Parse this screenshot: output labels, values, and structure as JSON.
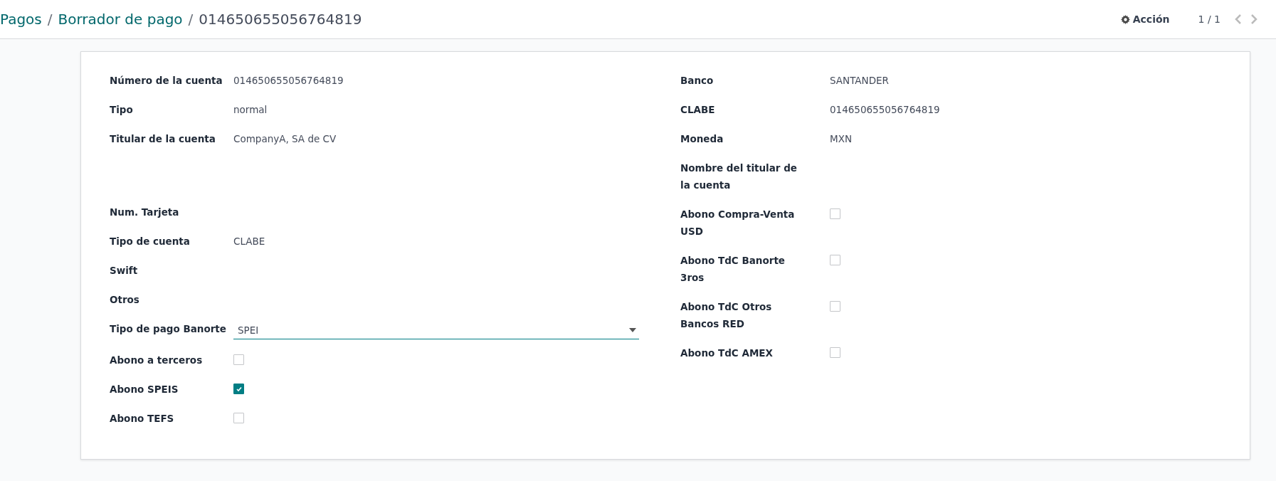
{
  "breadcrumbs": [
    {
      "label": "Pagos",
      "kind": "link"
    },
    {
      "label": "Borrador de pago",
      "kind": "link"
    },
    {
      "label": "014650655056764819",
      "kind": "current"
    }
  ],
  "separator": "/",
  "action_button": {
    "label": "Acción"
  },
  "pager": {
    "text": "1 / 1"
  },
  "left_fields": [
    {
      "label": "Número de la cuenta",
      "kind": "text",
      "value": "014650655056764819"
    },
    {
      "label": "Tipo",
      "kind": "text",
      "value": "normal"
    },
    {
      "label": "Titular de la cuenta",
      "kind": "textarea",
      "value": "CompanyA, SA de CV"
    },
    {
      "label": "Num. Tarjeta",
      "kind": "text"
    },
    {
      "label": "Tipo de cuenta",
      "kind": "text",
      "value": "CLABE"
    },
    {
      "label": "Swift",
      "kind": "text"
    },
    {
      "label": "Otros",
      "kind": "text"
    },
    {
      "label": "Tipo de pago Banorte",
      "kind": "select",
      "value": "SPEI"
    },
    {
      "label": "Abono a terceros",
      "kind": "checkbox",
      "checked": false
    },
    {
      "label": "Abono SPEIS",
      "kind": "checkbox",
      "checked": true
    },
    {
      "label": "Abono TEFS",
      "kind": "checkbox",
      "checked": false
    }
  ],
  "right_fields": [
    {
      "label": "Banco",
      "kind": "text",
      "value": "SANTANDER"
    },
    {
      "label": "CLABE",
      "kind": "text",
      "value": "014650655056764819"
    },
    {
      "label": "Moneda",
      "kind": "text",
      "value": "MXN"
    },
    {
      "label": "Nombre del titular de la cuenta",
      "kind": "text"
    },
    {
      "label": "Abono Compra-Venta USD",
      "kind": "checkbox",
      "checked": false
    },
    {
      "label": "Abono TdC Banorte 3ros",
      "kind": "checkbox",
      "checked": false
    },
    {
      "label": "Abono TdC Otros Bancos RED",
      "kind": "checkbox",
      "checked": false
    },
    {
      "label": "Abono TdC AMEX",
      "kind": "checkbox",
      "checked": false
    }
  ]
}
